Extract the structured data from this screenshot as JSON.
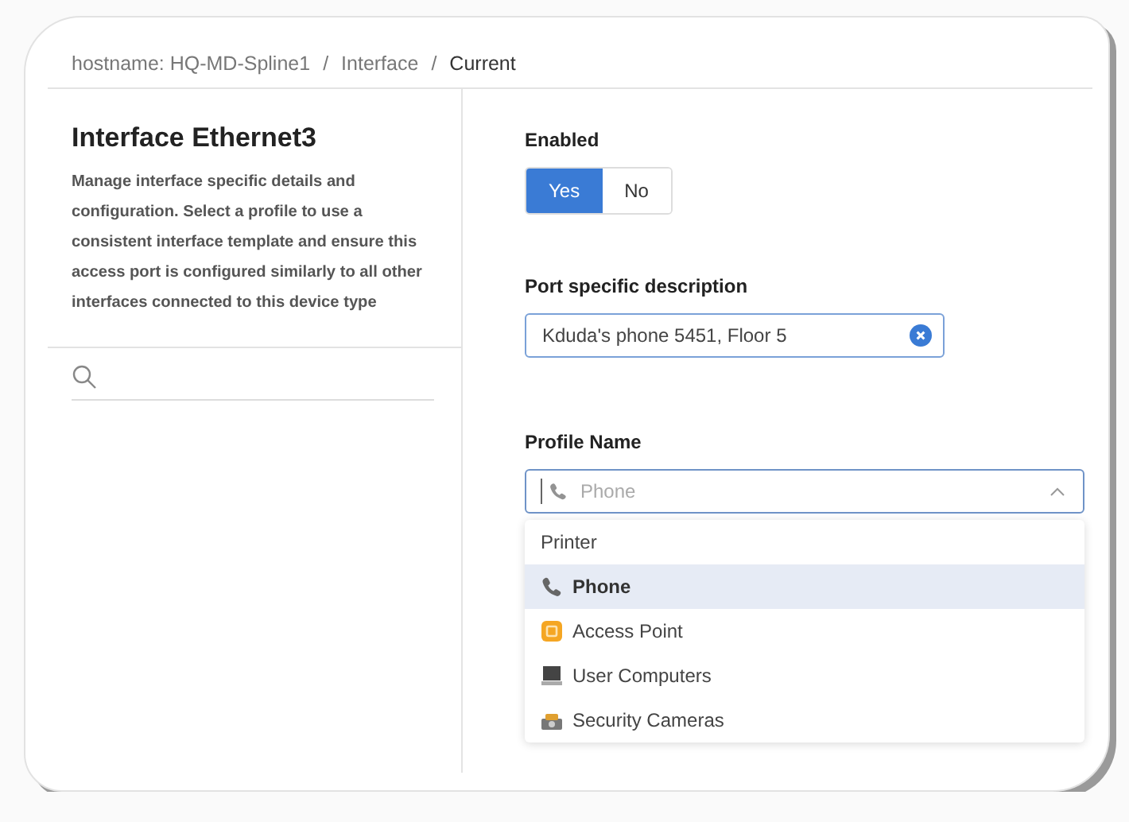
{
  "breadcrumb": [
    {
      "label": "hostname: HQ-MD-Spline1",
      "current": false
    },
    {
      "label": "Interface",
      "current": false
    },
    {
      "label": "Current",
      "current": true
    }
  ],
  "breadcrumb_separator": "/",
  "sidebar": {
    "title": "Interface Ethernet3",
    "description": "Manage interface specific details and configuration. Select a profile to use a consistent interface template and ensure this access port is configured similarly to all other interfaces connected to this device type"
  },
  "enabled": {
    "label": "Enabled",
    "options": [
      {
        "label": "Yes",
        "selected": true
      },
      {
        "label": "No",
        "selected": false
      }
    ]
  },
  "description_field": {
    "label": "Port specific description",
    "value": "Kduda's phone 5451, Floor 5"
  },
  "profile": {
    "label": "Profile Name",
    "placeholder": "Phone",
    "expanded": true,
    "options": [
      {
        "label": "Printer",
        "kind": "plain",
        "selected": false
      },
      {
        "label": "Phone",
        "kind": "phone",
        "selected": true
      },
      {
        "label": "Access Point",
        "kind": "access-point",
        "selected": false
      },
      {
        "label": "User Computers",
        "kind": "computer",
        "selected": false
      },
      {
        "label": "Security Cameras",
        "kind": "camera",
        "selected": false
      }
    ]
  }
}
